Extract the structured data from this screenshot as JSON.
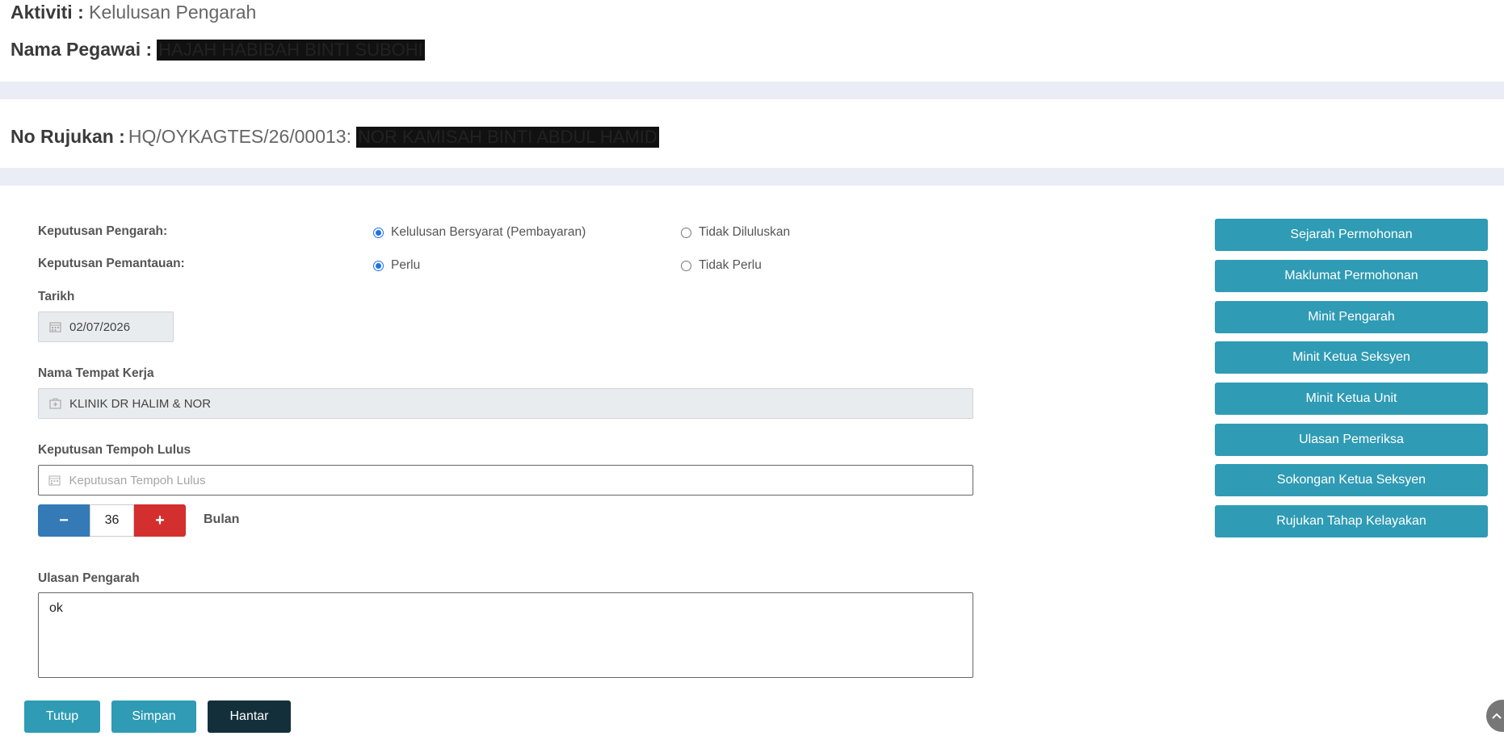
{
  "header": {
    "activity_label": "Aktiviti :",
    "activity_value": "Kelulusan Pengarah",
    "pegawai_label": "Nama Pegawai :",
    "pegawai_value": "HAJAH HABIBAH BINTI SUBOHI"
  },
  "reference": {
    "label": "No Rujukan :",
    "value": "HQ/OYKAGTES/26/00013:",
    "name": "NOR KAMISAH BINTI ABDUL HAMID"
  },
  "form": {
    "keputusan_pengarah": {
      "label": "Keputusan Pengarah:",
      "options": [
        "Kelulusan Bersyarat (Pembayaran)",
        "Tidak Diluluskan"
      ],
      "selected": "Kelulusan Bersyarat (Pembayaran)"
    },
    "keputusan_pemantauan": {
      "label": "Keputusan Pemantauan:",
      "options": [
        "Perlu",
        "Tidak Perlu"
      ],
      "selected": "Perlu"
    },
    "tarikh": {
      "label": "Tarikh",
      "value": "02/07/2026"
    },
    "tempat_kerja": {
      "label": "Nama Tempat Kerja",
      "value": "KLINIK DR HALIM & NOR"
    },
    "tempoh_lulus": {
      "label": "Keputusan Tempoh Lulus",
      "placeholder": "Keputusan Tempoh Lulus"
    },
    "stepper": {
      "minus": "−",
      "plus": "+",
      "value": "36",
      "unit": "Bulan"
    },
    "ulasan": {
      "label": "Ulasan Pengarah",
      "value": "ok"
    }
  },
  "side_buttons": [
    "Sejarah Permohonan",
    "Maklumat Permohonan",
    "Minit Pengarah",
    "Minit Ketua Seksyen",
    "Minit Ketua Unit",
    "Ulasan Pemeriksa",
    "Sokongan Ketua Seksyen",
    "Rujukan Tahap Kelayakan"
  ],
  "actions": {
    "tutup": "Tutup",
    "simpan": "Simpan",
    "hantar": "Hantar"
  },
  "colors": {
    "teal": "#2f9bb4",
    "dark": "#13303a",
    "blue": "#337ab7",
    "red": "#d32f2f",
    "band": "#eaedf5"
  }
}
